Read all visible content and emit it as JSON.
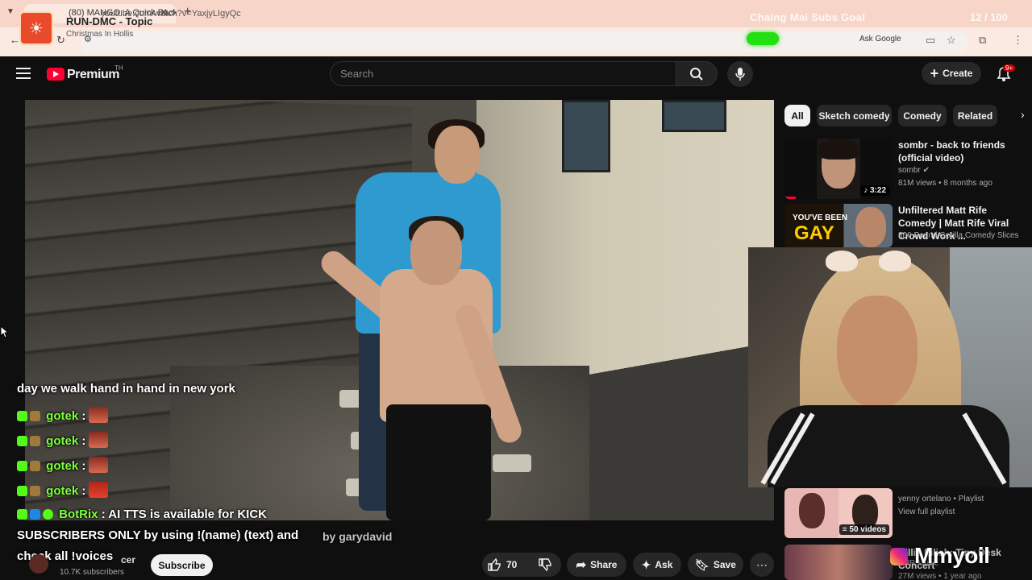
{
  "browser": {
    "tab_title": "(80) MANGO: A Quick Back Sto...",
    "url": "youtube.com/watch?v=YaxjyLIgyQc",
    "ask_google": "Ask Google"
  },
  "overlay": {
    "now_playing_artist": "RUN-DMC - Topic",
    "now_playing_track": "Christmas In Hollis",
    "goal_label": "Chaing Mai Subs Goal",
    "goal_count": "12 / 100",
    "goal_progress": 0.12,
    "watermark": "Mmyoil"
  },
  "header": {
    "brand": "Premium",
    "region": "TH",
    "search_placeholder": "Search",
    "create_label": "Create",
    "notif_badge": "9+"
  },
  "chat": {
    "line0": "day we walk hand in hand in new york",
    "messages": [
      {
        "user": "gotek",
        "text": ":"
      },
      {
        "user": "gotek",
        "text": ":"
      },
      {
        "user": "gotek",
        "text": ":"
      },
      {
        "user": "gotek",
        "text": ":"
      }
    ],
    "bot_user": "BotRix",
    "bot_text1": ": AI TTS is available for KICK",
    "bot_text2": "SUBSCRIBERS ONLY by using !(name) (text) and",
    "bot_text3": "check all !voices",
    "bot_ghost": "by garydavid"
  },
  "video_bar": {
    "channel_name": "cer",
    "channel_subs": "10.7K subscribers",
    "subscribe": "Subscribe",
    "likes": "70",
    "share": "Share",
    "ask": "Ask",
    "save": "Save"
  },
  "chips": [
    "All",
    "Sketch comedy",
    "Comedy",
    "Related"
  ],
  "recommendations": [
    {
      "title": "sombr - back to friends (official video)",
      "channel": "sombr",
      "meta": "81M views • 8 months ago",
      "duration": "3:22",
      "thumb_text": ""
    },
    {
      "title": "Unfiltered Matt Rife Comedy | Matt Rife Viral Crowd Work ...",
      "channel": "800 Pound Gorilla Comedy Slices",
      "meta": "",
      "duration": "",
      "thumb_text": "YOU'VE BEEN GAY"
    },
    {
      "title": "",
      "channel": "yenny ortelano • Playlist",
      "meta": "View full playlist",
      "duration": "50 videos",
      "thumb_text": ""
    },
    {
      "title": "Billie Eilish: Tiny Desk Concert",
      "channel": "NPR Music",
      "meta": "27M views • 1 year ago",
      "duration": "",
      "thumb_text": ""
    }
  ],
  "colors": {
    "yt_red": "#ff0033",
    "goal_green": "#23e012",
    "chat_user": "#7dff3a"
  }
}
